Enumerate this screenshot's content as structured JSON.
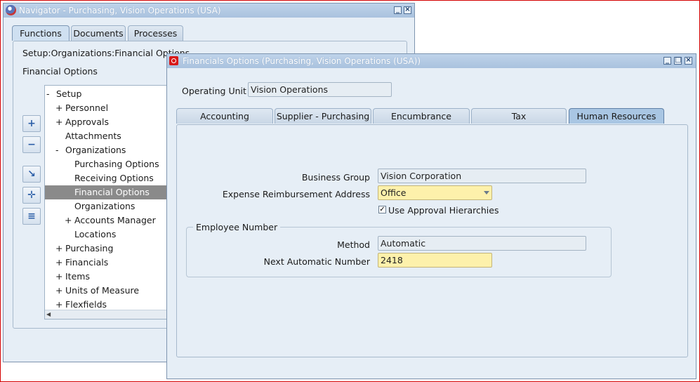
{
  "navigator": {
    "title": "Navigator - Purchasing, Vision Operations (USA)",
    "tabs": [
      "Functions",
      "Documents",
      "Processes"
    ],
    "path": "Setup:Organizations:Financial Options",
    "selected_label": "Financial Options",
    "tree": [
      {
        "sign": "-",
        "label": "Setup"
      },
      {
        "sign": "+",
        "label": "Personnel"
      },
      {
        "sign": "+",
        "label": "Approvals"
      },
      {
        "sign": "",
        "label": "Attachments"
      },
      {
        "sign": "-",
        "label": "Organizations"
      },
      {
        "sign": "",
        "label": "Purchasing Options"
      },
      {
        "sign": "",
        "label": "Receiving Options"
      },
      {
        "sign": "",
        "label": "Financial Options"
      },
      {
        "sign": "",
        "label": "Organizations"
      },
      {
        "sign": "+",
        "label": "Accounts Manager"
      },
      {
        "sign": "",
        "label": "Locations"
      },
      {
        "sign": "+",
        "label": "Purchasing"
      },
      {
        "sign": "+",
        "label": "Financials"
      },
      {
        "sign": "+",
        "label": "Items"
      },
      {
        "sign": "+",
        "label": "Units of Measure"
      },
      {
        "sign": "+",
        "label": "Flexfields"
      }
    ]
  },
  "financials": {
    "title": "Financials Options (Purchasing, Vision Operations (USA))",
    "operating_unit_label": "Operating Unit",
    "operating_unit_value": "Vision Operations",
    "tabs": [
      "Accounting",
      "Supplier - Purchasing",
      "Encumbrance",
      "Tax",
      "Human Resources"
    ],
    "business_group_label": "Business Group",
    "business_group_value": "Vision Corporation",
    "expense_address_label": "Expense Reimbursement Address",
    "expense_address_value": "Office",
    "approval_checkbox_label": "Use Approval Hierarchies",
    "approval_checked": true,
    "employee_number_group": "Employee Number",
    "method_label": "Method",
    "method_value": "Automatic",
    "next_number_label": "Next Automatic Number",
    "next_number_value": "2418"
  }
}
